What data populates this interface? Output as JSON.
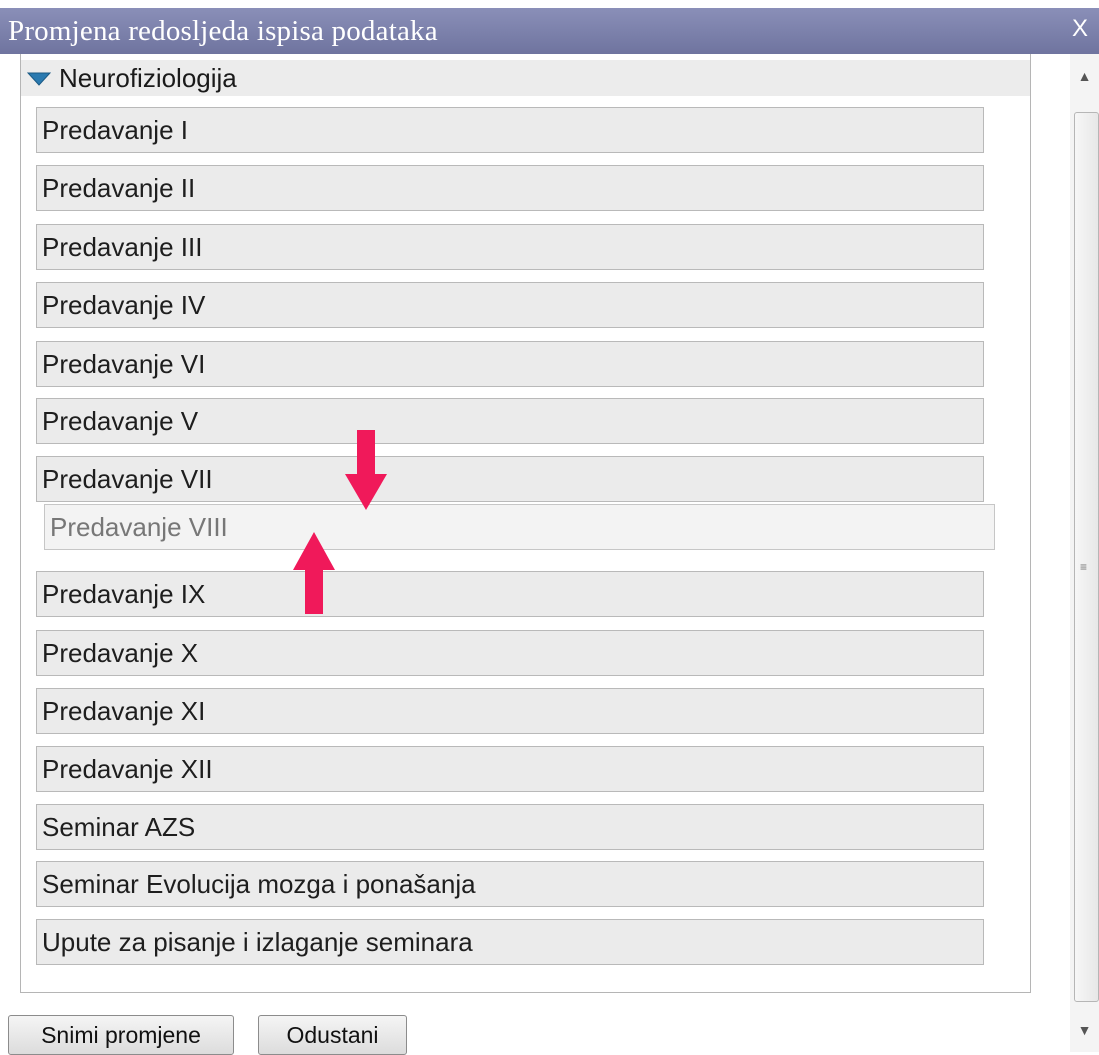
{
  "dialog": {
    "title": "Promjena redosljeda ispisa podataka",
    "close_label": "X"
  },
  "group": {
    "name": "Neurofiziologija",
    "expanded": true,
    "icon": "caret-down-icon",
    "icon_color": "#2a7ab0"
  },
  "items": [
    "Predavanje I",
    "Predavanje II",
    "Predavanje III",
    "Predavanje IV",
    "Predavanje VI",
    "Predavanje V",
    "Predavanje VII",
    "Predavanje VIII",
    "Predavanje IX",
    "Predavanje X",
    "Predavanje XI",
    "Predavanje XII",
    "Seminar AZS",
    "Seminar Evolucija mozga i ponašanja",
    "Upute za pisanje i izlaganje seminara"
  ],
  "dragging_item_index": 7,
  "annotation": {
    "icon": "arrow-icon",
    "color": "#f0195a"
  },
  "buttons": {
    "save": "Snimi promjene",
    "cancel": "Odustani"
  }
}
